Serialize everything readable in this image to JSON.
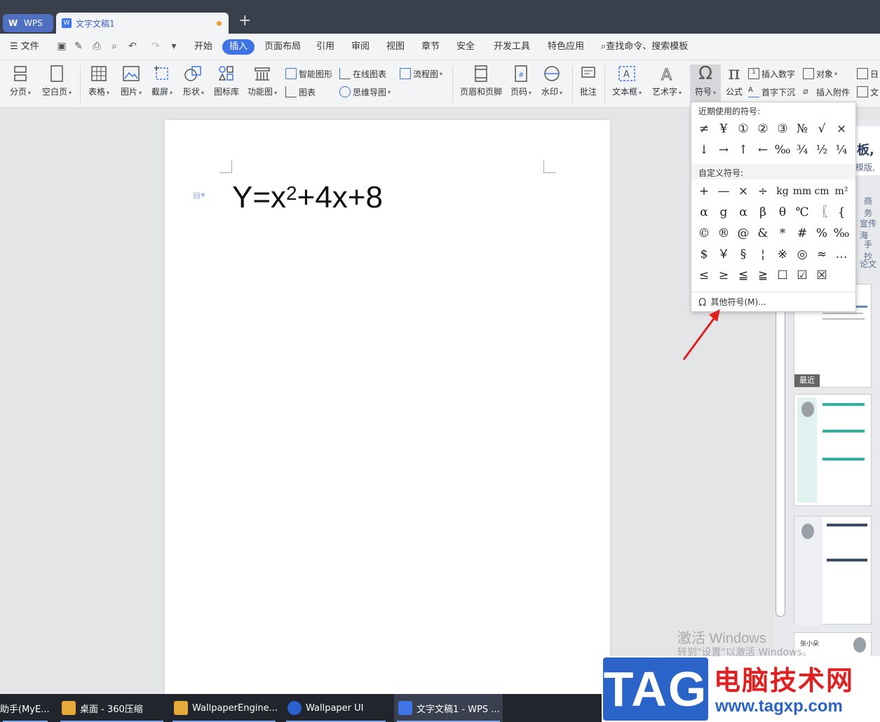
{
  "titlebar": {
    "wps_tab": "WPS",
    "doc_tab": "文字文稿1",
    "add_tab": "+"
  },
  "menubar": {
    "file": "文件",
    "items": [
      "开始",
      "插入",
      "页面布局",
      "引用",
      "审阅",
      "视图",
      "章节",
      "安全",
      "开发工具",
      "特色应用"
    ],
    "search": "查找命令、搜索模板"
  },
  "ribbon": {
    "page_break": "分页",
    "blank_page": "空白页",
    "table": "表格",
    "picture": "图片",
    "screenshot": "截屏",
    "shape": "形状",
    "icon_lib": "图标库",
    "func_chart": "功能图",
    "smart_shape": "智能图形",
    "chart": "图表",
    "online_chart": "在线图表",
    "mind_map": "思维导图",
    "flowchart": "流程图",
    "header_footer": "页眉和页脚",
    "page_num": "页码",
    "watermark": "水印",
    "comment": "批注",
    "textbox": "文本框",
    "wordart": "艺术字",
    "symbol": "符号",
    "formula": "公式",
    "insert_number": "插入数字",
    "object": "对象",
    "drop_cap": "首字下沉",
    "attachment": "插入附件",
    "date": "日",
    "doc": "文"
  },
  "document": {
    "formula_base": "Y=x",
    "formula_sup": "2",
    "formula_rest": "+4x+8"
  },
  "symbol_menu": {
    "recent_title": "近期使用的符号:",
    "recent": [
      "≠",
      "¥",
      "①",
      "②",
      "③",
      "№",
      "√",
      "×",
      "↓",
      "→",
      "↑",
      "←",
      "‰",
      "¾",
      "½",
      "¼"
    ],
    "custom_title": "自定义符号:",
    "custom": [
      "+",
      "—",
      "×",
      "÷",
      "kg",
      "mm",
      "cm",
      "m²",
      "α",
      "g",
      "α",
      "β",
      "θ",
      "℃",
      "〖",
      "{",
      "©",
      "®",
      "@",
      "&",
      "*",
      "#",
      "%",
      "‰",
      "$",
      "￥",
      "§",
      "¦",
      "※",
      "◎",
      "≈",
      "…",
      "≤",
      "≥",
      "≦",
      "≧",
      "☐",
      "☑",
      "☒"
    ],
    "other": "其他符号(M)..."
  },
  "right_pane": {
    "title_frag": "板,",
    "sub_frag": "模版,",
    "tags": [
      "商务",
      "宣传海",
      "手抄",
      "论文"
    ],
    "recent_badge": "最近",
    "card_name": "张小朵"
  },
  "watermark": {
    "line1": "激活 Windows",
    "line2": "转到\"设置\"以激活 Windows。"
  },
  "tag": {
    "box": "TAG",
    "cn": "电脑技术网",
    "url": "www.tagxp.com"
  },
  "taskbar": {
    "items": [
      "助手(MyE...",
      "桌面 - 360压缩",
      "WallpaperEngine...",
      "Wallpaper UI",
      "文字文稿1 - WPS ..."
    ]
  }
}
